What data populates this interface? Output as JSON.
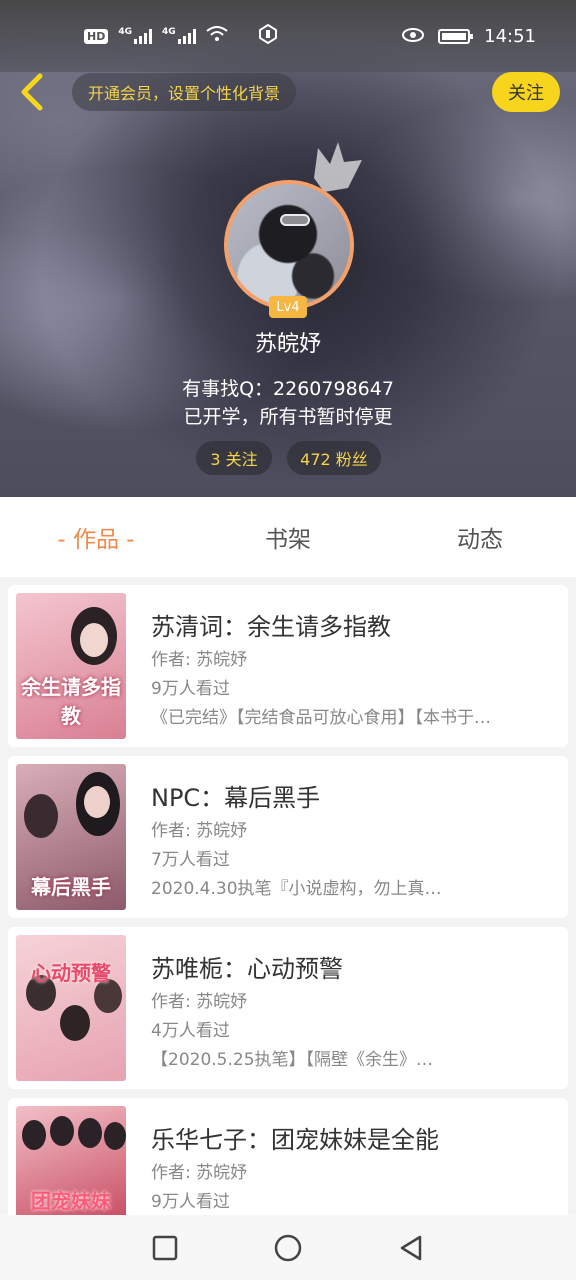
{
  "status_bar": {
    "hd_label": "HD",
    "net1": "4G",
    "net2": "4G",
    "time": "14:51"
  },
  "header": {
    "vip_prompt": "开通会员，设置个性化背景",
    "follow_label": "关注",
    "level": "Lv4",
    "username": "苏皖妤",
    "bio_line1": "有事找Q：2260798647",
    "bio_line2": "已开学，所有书暂时停更",
    "following": "3 关注",
    "fans": "472 粉丝"
  },
  "tabs": [
    {
      "label": "- 作品 -",
      "active": true
    },
    {
      "label": "书架",
      "active": false
    },
    {
      "label": "动态",
      "active": false
    }
  ],
  "books": [
    {
      "title": "苏清词：余生请多指教",
      "author": "作者: 苏皖妤",
      "views": "9万人看过",
      "desc": "《已完结》【完结食品可放心食用】【本书于…",
      "cover_text": "余生请多指教",
      "cover_colors": [
        "#f3c6cf",
        "#d98093"
      ]
    },
    {
      "title": "NPC：幕后黑手",
      "author": "作者: 苏皖妤",
      "views": "7万人看过",
      "desc": "2020.4.30执笔『小说虚构，勿上真…",
      "cover_text": "幕后黑手",
      "cover_colors": [
        "#d9aeb8",
        "#8c5a6a"
      ]
    },
    {
      "title": "苏唯栀：心动预警",
      "author": "作者: 苏皖妤",
      "views": "4万人看过",
      "desc": "【2020.5.25执笔】【隔壁《余生》…",
      "cover_text": "心动预警",
      "cover_colors": [
        "#f6d3d8",
        "#e6a2b0"
      ]
    },
    {
      "title": "乐华七子：团宠妹妹是全能",
      "author": "作者: 苏皖妤",
      "views": "9万人看过",
      "desc": "",
      "cover_text": "团宠妹妹",
      "cover_colors": [
        "#f2c0c8",
        "#c6485e"
      ]
    }
  ],
  "colors": {
    "accent": "#f08a4b",
    "follow_yellow": "#f7d51d",
    "stat_text": "#f5d34a"
  }
}
